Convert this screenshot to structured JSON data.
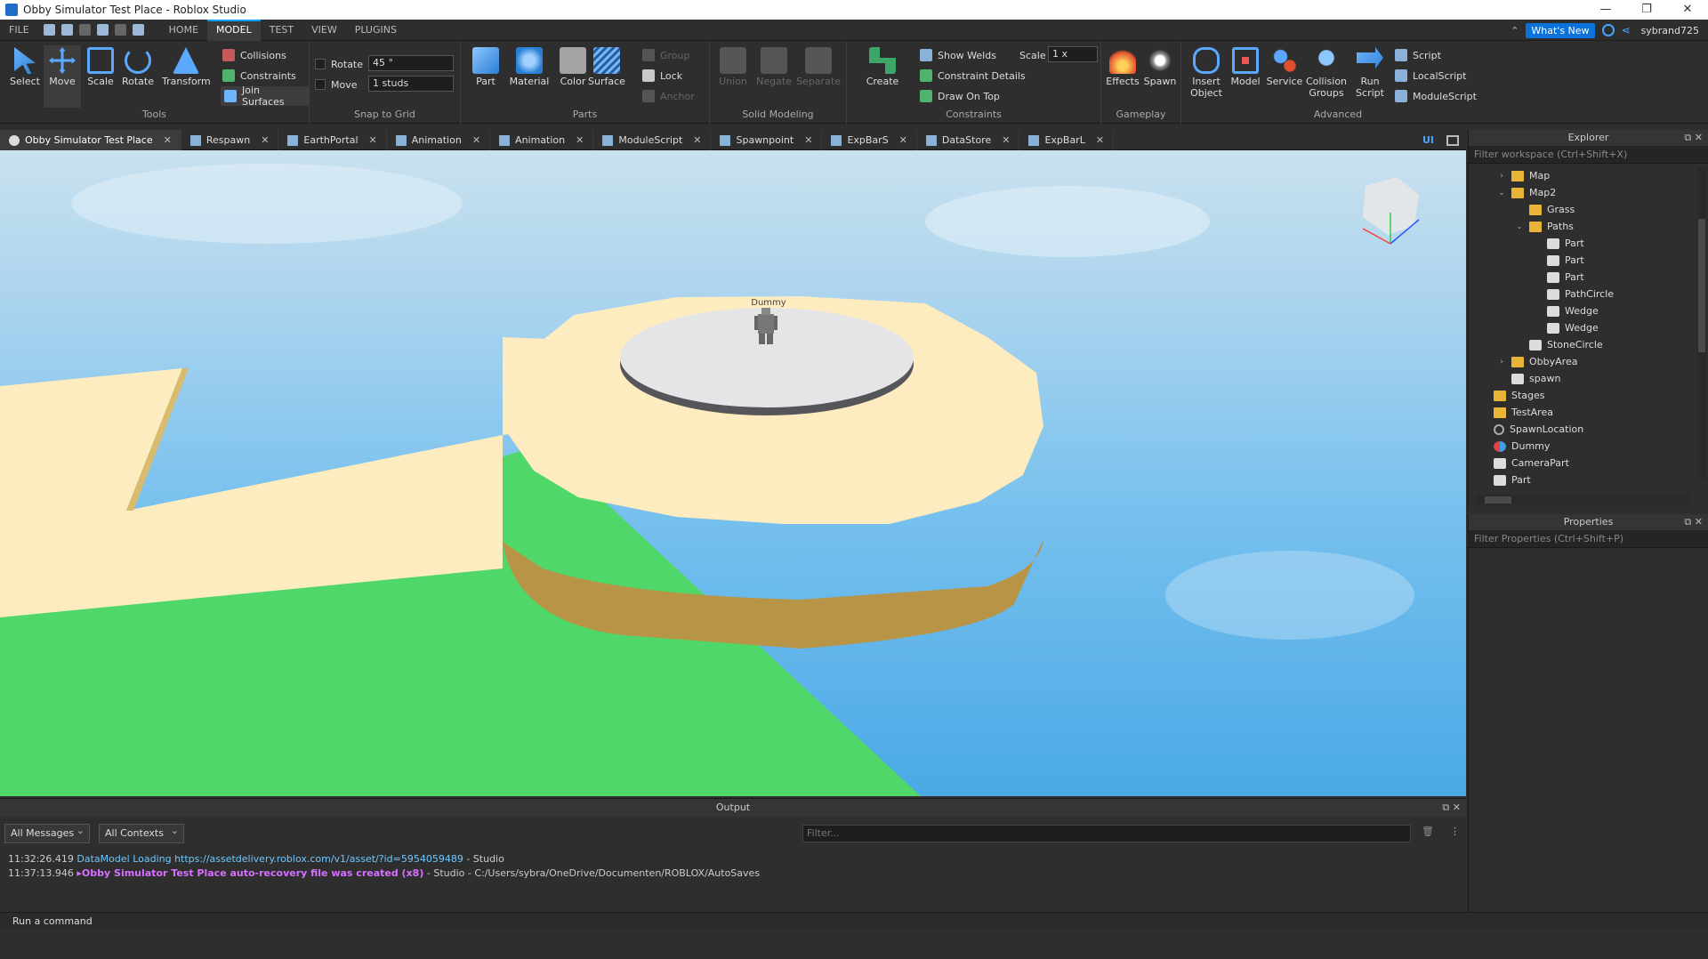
{
  "window": {
    "title": "Obby Simulator Test Place - Roblox Studio",
    "controls": [
      "—",
      "❐",
      "✕"
    ]
  },
  "menu": {
    "items": [
      "FILE",
      "HOME",
      "MODEL",
      "TEST",
      "VIEW",
      "PLUGINS"
    ],
    "active": "MODEL",
    "whats_new": "What's New",
    "username": "sybrand725"
  },
  "ribbon": {
    "tools": {
      "label": "Tools",
      "select": "Select",
      "move": "Move",
      "scale": "Scale",
      "rotate": "Rotate",
      "transform": "Transform",
      "collisions": "Collisions",
      "constraints": "Constraints",
      "join_surfaces": "Join Surfaces"
    },
    "snap": {
      "label": "Snap to Grid",
      "rotate": "Rotate",
      "rotate_value": "45 °",
      "move": "Move",
      "move_value": "1 studs"
    },
    "parts": {
      "label": "Parts",
      "part": "Part",
      "material": "Material",
      "color": "Color",
      "surface": "Surface",
      "group": "Group",
      "lock": "Lock",
      "anchor": "Anchor"
    },
    "solid": {
      "label": "Solid Modeling",
      "union": "Union",
      "negate": "Negate",
      "separate": "Separate"
    },
    "constraints": {
      "label": "Constraints",
      "create": "Create",
      "show_welds": "Show Welds",
      "constraint_details": "Constraint Details",
      "draw_on_top": "Draw On Top",
      "scale": "Scale",
      "scale_value": "1 x"
    },
    "gameplay": {
      "label": "Gameplay",
      "effects": "Effects",
      "spawn": "Spawn"
    },
    "advanced": {
      "label": "Advanced",
      "insert_object_1": "Insert",
      "insert_object_2": "Object",
      "model": "Model",
      "service": "Service",
      "collision_1": "Collision",
      "collision_2": "Groups",
      "run_1": "Run",
      "run_2": "Script",
      "script": "Script",
      "local_script": "LocalScript",
      "module_script": "ModuleScript"
    }
  },
  "tabs": [
    {
      "label": "Obby Simulator Test Place",
      "active": true
    },
    {
      "label": "Respawn"
    },
    {
      "label": "EarthPortal"
    },
    {
      "label": "Animation"
    },
    {
      "label": "Animation"
    },
    {
      "label": "ModuleScript"
    },
    {
      "label": "Spawnpoint"
    },
    {
      "label": "ExpBarS"
    },
    {
      "label": "DataStore"
    },
    {
      "label": "ExpBarL"
    }
  ],
  "tabs_right": {
    "ui": "UI"
  },
  "viewport": {
    "dummy_label": "Dummy",
    "colors": {
      "platform": "#fdecc0",
      "green": "#4fd869",
      "sky": "#5ab6ea"
    }
  },
  "output": {
    "title": "Output",
    "messages_filter": "All Messages",
    "contexts_filter": "All Contexts",
    "filter_placeholder": "Filter...",
    "log": [
      {
        "time": "11:32:26.419",
        "text": "DataModel Loading https://assetdelivery.roblox.com/v1/asset/?id=5954059489",
        "source": " - Studio"
      },
      {
        "time": "11:37:13.946",
        "text": "▸Obby Simulator Test Place auto-recovery file was created (x8)",
        "source": " - Studio - C:/Users/sybra/OneDrive/Documenten/ROBLOX/AutoSaves"
      }
    ]
  },
  "command_bar": {
    "placeholder": "Run a command"
  },
  "explorer": {
    "title": "Explorer",
    "filter": "Filter workspace (Ctrl+Shift+X)",
    "items": [
      {
        "label": "Map",
        "icon": "folder",
        "depth": 1,
        "arrow": "›"
      },
      {
        "label": "Map2",
        "icon": "folder",
        "depth": 1,
        "arrow": "⌄"
      },
      {
        "label": "Grass",
        "icon": "folder",
        "depth": 2,
        "arrow": ""
      },
      {
        "label": "Paths",
        "icon": "folder",
        "depth": 2,
        "arrow": "⌄"
      },
      {
        "label": "Part",
        "icon": "part",
        "depth": 3,
        "arrow": ""
      },
      {
        "label": "Part",
        "icon": "part",
        "depth": 3,
        "arrow": ""
      },
      {
        "label": "Part",
        "icon": "part",
        "depth": 3,
        "arrow": ""
      },
      {
        "label": "PathCircle",
        "icon": "part",
        "depth": 3,
        "arrow": ""
      },
      {
        "label": "Wedge",
        "icon": "part",
        "depth": 3,
        "arrow": ""
      },
      {
        "label": "Wedge",
        "icon": "part",
        "depth": 3,
        "arrow": ""
      },
      {
        "label": "StoneCircle",
        "icon": "part",
        "depth": 2,
        "arrow": ""
      },
      {
        "label": "ObbyArea",
        "icon": "folder",
        "depth": 1,
        "arrow": "›"
      },
      {
        "label": "spawn",
        "icon": "part",
        "depth": 1,
        "arrow": ""
      },
      {
        "label": "Stages",
        "icon": "folder",
        "depth": 0,
        "arrow": ""
      },
      {
        "label": "TestArea",
        "icon": "folder",
        "depth": 0,
        "arrow": ""
      },
      {
        "label": "SpawnLocation",
        "icon": "spawn",
        "depth": 0,
        "arrow": ""
      },
      {
        "label": "Dummy",
        "icon": "dummy",
        "depth": 0,
        "arrow": ""
      },
      {
        "label": "CameraPart",
        "icon": "part",
        "depth": 0,
        "arrow": ""
      },
      {
        "label": "Part",
        "icon": "part",
        "depth": 0,
        "arrow": ""
      }
    ]
  },
  "properties": {
    "title": "Properties",
    "filter": "Filter Properties (Ctrl+Shift+P)"
  }
}
